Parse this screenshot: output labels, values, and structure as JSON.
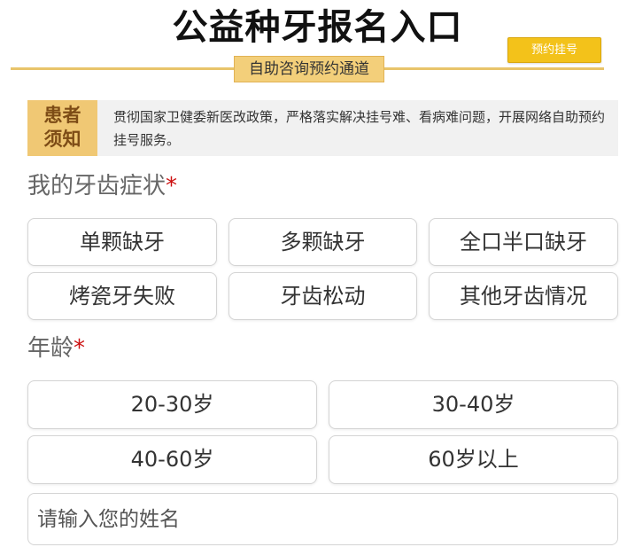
{
  "header": {
    "title": "公益种牙报名入口",
    "subtitle": "自助咨询预约通道",
    "register_button": "预约挂号"
  },
  "notice": {
    "label_line1": "患者",
    "label_line2": "须知",
    "text": "贯彻国家卫健委新医改政策，严格落实解决挂号难、看病难问题，开展网络自助预约挂号服务。"
  },
  "symptoms": {
    "title": "我的牙齿症状",
    "required_mark": "*",
    "options": [
      "单颗缺牙",
      "多颗缺牙",
      "全口半口缺牙",
      "烤瓷牙失败",
      "牙齿松动",
      "其他牙齿情况"
    ]
  },
  "age": {
    "title": "年龄",
    "required_mark": "*",
    "options": [
      "20-30岁",
      "30-40岁",
      "40-60岁",
      "60岁以上"
    ]
  },
  "name_input": {
    "placeholder": "请输入您的姓名",
    "value": ""
  },
  "colors": {
    "accent_gold": "#f0c874",
    "button_yellow": "#f3c21a",
    "required_red": "#cc1111"
  }
}
